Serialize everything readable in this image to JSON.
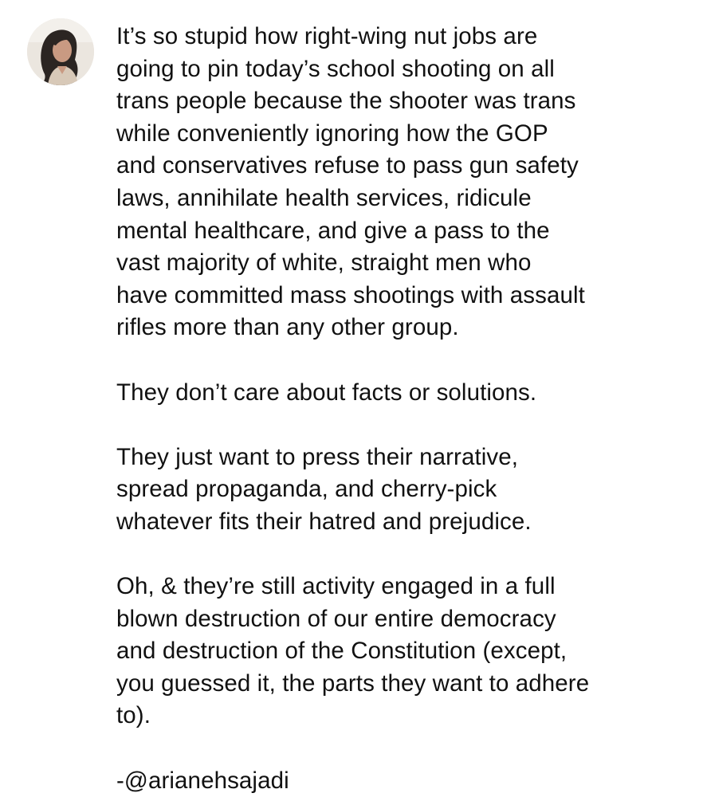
{
  "post": {
    "avatar_icon": "profile-photo-avatar",
    "paragraphs": [
      [
        "It’s so stupid how right-wing nut jobs are",
        "going to pin today’s school shooting on all",
        "trans people because the shooter was trans",
        "while conveniently ignoring how the GOP",
        "and conservatives refuse to pass gun safety",
        "laws, annihilate health services, ridicule",
        "mental healthcare, and give a pass to the",
        "vast majority of white, straight men who",
        "have committed mass shootings with assault",
        "rifles more than any other group."
      ],
      [
        "They don’t care about facts or solutions."
      ],
      [
        "They just want to press their narrative,",
        "spread propaganda, and cherry-pick",
        "whatever fits their hatred and prejudice."
      ],
      [
        "Oh, & they’re still activity engaged in a full",
        "blown destruction of our entire democracy",
        "and destruction of the Constitution (except,",
        "you guessed it, the parts they want to adhere",
        "to)."
      ],
      [
        "-@arianehsajadi"
      ]
    ]
  }
}
